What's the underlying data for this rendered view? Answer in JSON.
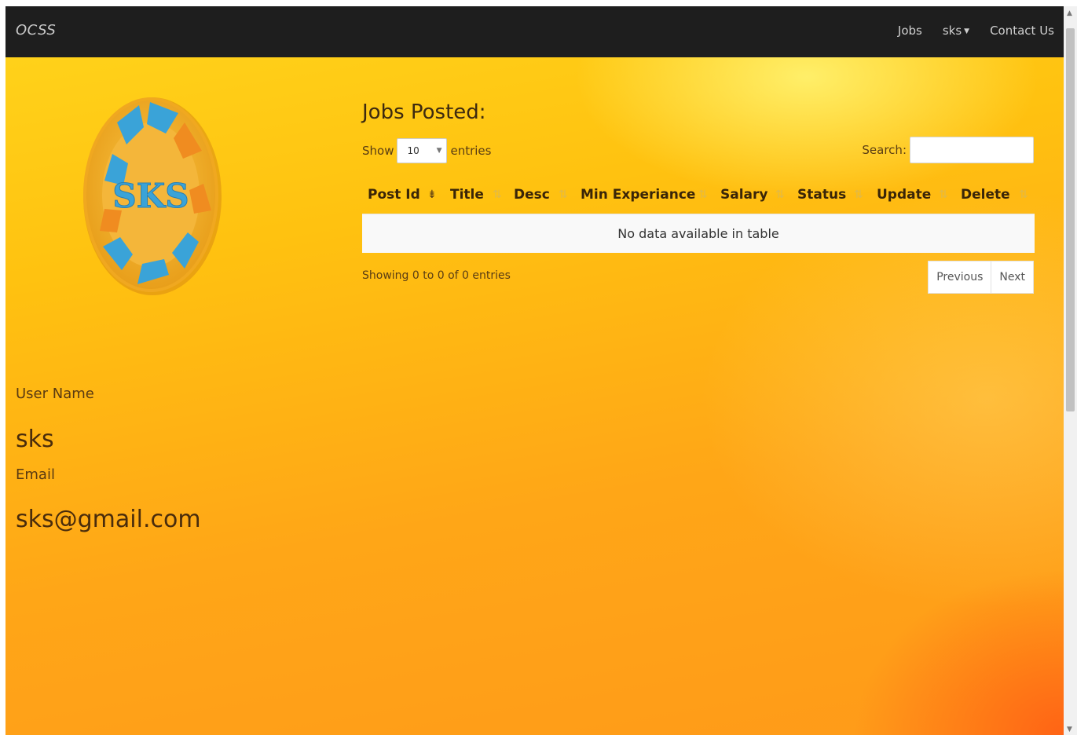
{
  "navbar": {
    "brand": "OCSS",
    "items": [
      {
        "label": "Jobs"
      },
      {
        "label": "sks"
      },
      {
        "label": "Contact Us"
      }
    ]
  },
  "logo": {
    "text": "SKS"
  },
  "profile": {
    "username_label": "User Name",
    "username": "sks",
    "email_label": "Email",
    "email": "sks@gmail.com"
  },
  "jobs": {
    "title": "Jobs Posted:",
    "show_label": "Show",
    "entries_count": "10",
    "entries_label": "entries",
    "search_label": "Search:",
    "search_value": "",
    "columns": [
      {
        "label": "Post Id"
      },
      {
        "label": "Title"
      },
      {
        "label": "Desc"
      },
      {
        "label": "Min Experiance"
      },
      {
        "label": "Salary"
      },
      {
        "label": "Status"
      },
      {
        "label": "Update"
      },
      {
        "label": "Delete"
      }
    ],
    "empty_message": "No data available in table",
    "info": "Showing 0 to 0 of 0 entries",
    "previous": "Previous",
    "next": "Next"
  },
  "colors": {
    "navbar": "#1e1e1e",
    "background_top": "#ffd51c",
    "background_bottom": "#ff9a19",
    "logo_ring": "#f5b530",
    "logo_accent": "#3aa3d8"
  },
  "icons": {
    "sort": "sort-arrows-icon",
    "sort_active": "sort-ascending-icon",
    "caret": "caret-down-icon",
    "select": "chevron-down-icon"
  }
}
